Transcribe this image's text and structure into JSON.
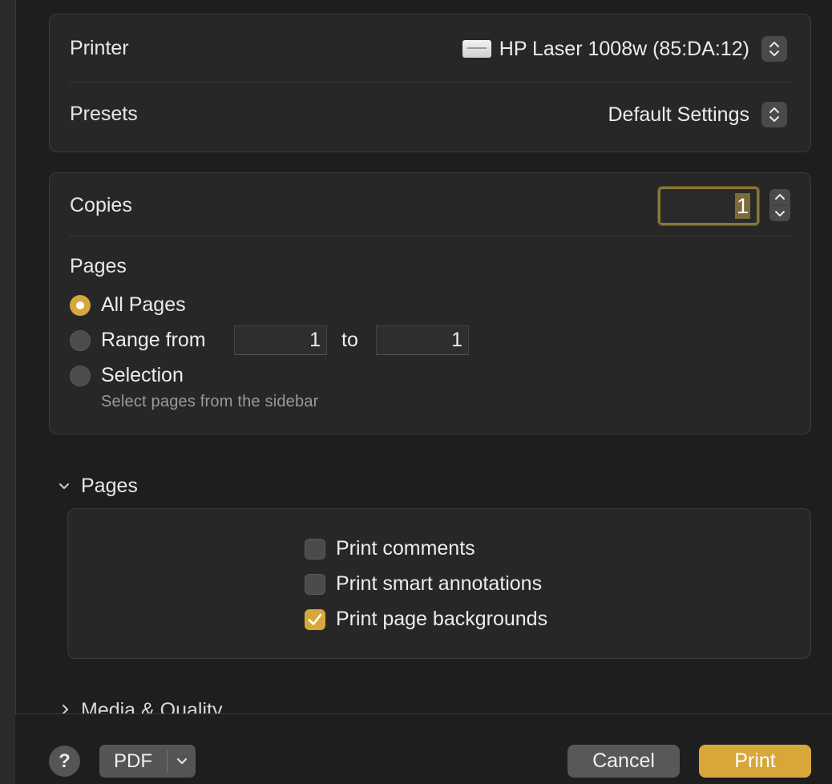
{
  "printer_panel": {
    "printer_label": "Printer",
    "printer_value": "HP Laser 1008w (85:DA:12)",
    "printer_icon": "printer-icon",
    "presets_label": "Presets",
    "presets_value": "Default Settings"
  },
  "copies_panel": {
    "copies_label": "Copies",
    "copies_value": "1",
    "pages_label": "Pages",
    "all_pages_label": "All Pages",
    "range_from_label": "Range from",
    "range_from_value": "1",
    "range_to_label": "to",
    "range_to_value": "1",
    "selection_label": "Selection",
    "selection_hint": "Select pages from the sidebar",
    "selected_option": "All Pages"
  },
  "pages_section": {
    "title": "Pages",
    "expanded": true,
    "options": [
      {
        "label": "Print comments",
        "checked": false
      },
      {
        "label": "Print smart annotations",
        "checked": false
      },
      {
        "label": "Print page backgrounds",
        "checked": true
      }
    ]
  },
  "media_section": {
    "title": "Media & Quality",
    "expanded": false
  },
  "footer": {
    "help_label": "?",
    "pdf_label": "PDF",
    "cancel_label": "Cancel",
    "print_label": "Print"
  },
  "colors": {
    "accent": "#d8a73a",
    "background": "#1e1e1e",
    "panel": "#272727"
  }
}
